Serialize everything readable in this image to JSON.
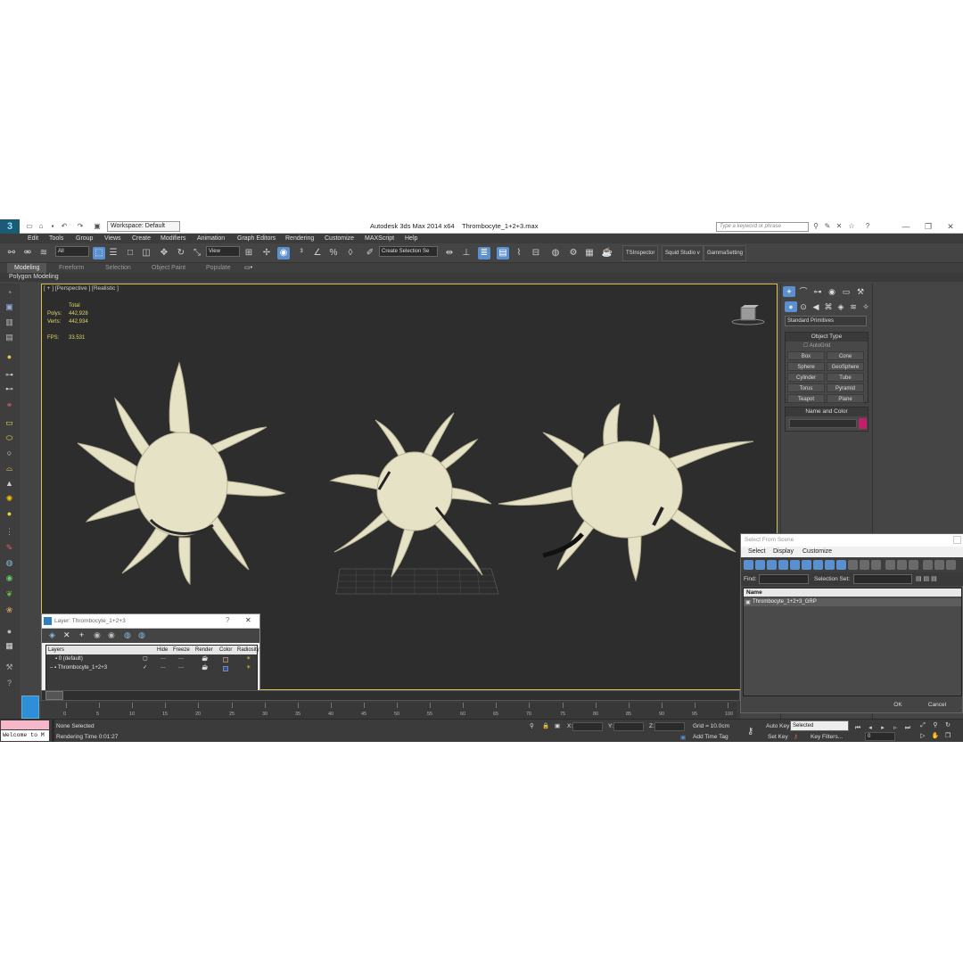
{
  "window": {
    "app_title": "Autodesk 3ds Max  2014 x64",
    "file_title": "Thrombocyte_1+2+3.max",
    "workspace": "Workspace: Default",
    "search_placeholder": "Type a keyword or phrase"
  },
  "menu": [
    "Edit",
    "Tools",
    "Group",
    "Views",
    "Create",
    "Modifiers",
    "Animation",
    "Graph Editors",
    "Rendering",
    "Customize",
    "MAXScript",
    "Help"
  ],
  "toolbar": {
    "filter": "All",
    "coord_system": "View",
    "selection_set": "Create Selection Se",
    "buttons": [
      "TSInspector",
      "Squid Studio v",
      "GammaSetting"
    ]
  },
  "ribbon": {
    "tabs": [
      "Modeling",
      "Freeform",
      "Selection",
      "Object Paint",
      "Populate"
    ],
    "active": "Modeling",
    "subtitle": "Polygon Modeling"
  },
  "viewport": {
    "label": "[ + ] [Perspective ] [Realistic ]",
    "stats": {
      "total_label": "Total",
      "polys_label": "Polys:",
      "polys": "442,928",
      "verts_label": "Verts:",
      "verts": "442,934",
      "fps_label": "FPS:",
      "fps": "33.531"
    }
  },
  "command_panel": {
    "category": "Standard Primitives",
    "object_type_title": "Object Type",
    "autogrid": "AutoGrid",
    "objects": [
      "Box",
      "Cone",
      "Sphere",
      "GeoSphere",
      "Cylinder",
      "Tube",
      "Torus",
      "Pyramid",
      "Teapot",
      "Plane"
    ],
    "name_color_title": "Name and Color",
    "swatch_color": "#c0206a"
  },
  "layer_dialog": {
    "title": "Layer: Thrombocyte_1+2+3",
    "columns": [
      "Layers",
      "Hide",
      "Freeze",
      "Render",
      "Color",
      "Radiosity"
    ],
    "rows": [
      {
        "name": "0 (default)"
      },
      {
        "name": "Thrombocyte_1+2+3"
      }
    ]
  },
  "select_from_scene": {
    "title": "Select From Scene",
    "menu": [
      "Select",
      "Display",
      "Customize"
    ],
    "find_label": "Find:",
    "selection_set_label": "Selection Set:",
    "column": "Name",
    "items": [
      "Thrombocyte_1+2+3_GRP"
    ],
    "ok": "OK",
    "cancel": "Cancel"
  },
  "timeline": {
    "slider": "0 / 100",
    "ticks": [
      "0",
      "5",
      "10",
      "15",
      "20",
      "25",
      "30",
      "35",
      "40",
      "45",
      "50",
      "55",
      "60",
      "65",
      "70",
      "75",
      "80",
      "85",
      "90",
      "95",
      "100"
    ]
  },
  "status": {
    "selection": "None Selected",
    "render_time": "Rendering Time  0:01:27",
    "x_label": "X:",
    "y_label": "Y:",
    "z_label": "Z:",
    "grid": "Grid = 10.0cm",
    "add_time_tag": "Add Time Tag",
    "auto_key": "Auto Key",
    "set_key": "Set Key",
    "key_mode": "Selected",
    "key_filters": "Key Filters...",
    "frame": "0",
    "welcome": "Welcome to M"
  }
}
